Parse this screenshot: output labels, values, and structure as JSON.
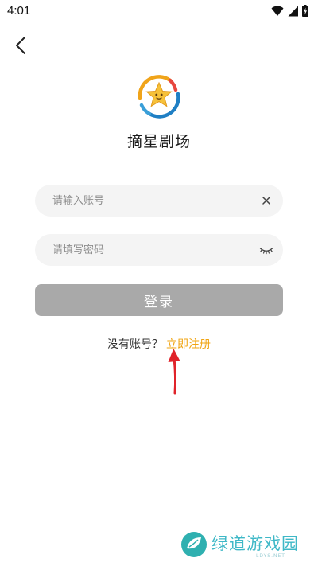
{
  "status_bar": {
    "time": "4:01"
  },
  "app": {
    "title": "摘星剧场"
  },
  "login_form": {
    "account_placeholder": "请输入账号",
    "password_placeholder": "请填写密码",
    "login_label": "登录"
  },
  "register": {
    "prompt": "没有账号？",
    "link_label": "立即注册"
  },
  "watermark": {
    "title": "绿道游戏园",
    "subtitle": "LDYS.NET"
  },
  "colors": {
    "accent_link": "#f0a412",
    "button_disabled": "#a9a9a9",
    "field_bg": "#f4f4f4",
    "annotation_arrow": "#e0232a",
    "watermark": "#3fb8c7"
  },
  "icons": [
    "wifi-icon",
    "signal-icon",
    "battery-charging-icon",
    "back-arrow-icon",
    "app-logo-icon",
    "clear-icon",
    "eye-closed-icon"
  ]
}
